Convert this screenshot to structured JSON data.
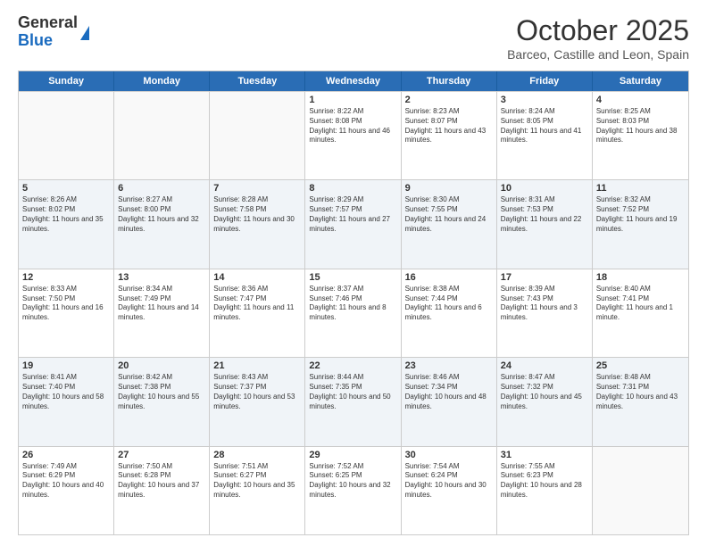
{
  "logo": {
    "general": "General",
    "blue": "Blue"
  },
  "title": "October 2025",
  "location": "Barceo, Castille and Leon, Spain",
  "header_days": [
    "Sunday",
    "Monday",
    "Tuesday",
    "Wednesday",
    "Thursday",
    "Friday",
    "Saturday"
  ],
  "weeks": [
    [
      {
        "date": "",
        "sunrise": "",
        "sunset": "",
        "daylight": ""
      },
      {
        "date": "",
        "sunrise": "",
        "sunset": "",
        "daylight": ""
      },
      {
        "date": "",
        "sunrise": "",
        "sunset": "",
        "daylight": ""
      },
      {
        "date": "1",
        "sunrise": "Sunrise: 8:22 AM",
        "sunset": "Sunset: 8:08 PM",
        "daylight": "Daylight: 11 hours and 46 minutes."
      },
      {
        "date": "2",
        "sunrise": "Sunrise: 8:23 AM",
        "sunset": "Sunset: 8:07 PM",
        "daylight": "Daylight: 11 hours and 43 minutes."
      },
      {
        "date": "3",
        "sunrise": "Sunrise: 8:24 AM",
        "sunset": "Sunset: 8:05 PM",
        "daylight": "Daylight: 11 hours and 41 minutes."
      },
      {
        "date": "4",
        "sunrise": "Sunrise: 8:25 AM",
        "sunset": "Sunset: 8:03 PM",
        "daylight": "Daylight: 11 hours and 38 minutes."
      }
    ],
    [
      {
        "date": "5",
        "sunrise": "Sunrise: 8:26 AM",
        "sunset": "Sunset: 8:02 PM",
        "daylight": "Daylight: 11 hours and 35 minutes."
      },
      {
        "date": "6",
        "sunrise": "Sunrise: 8:27 AM",
        "sunset": "Sunset: 8:00 PM",
        "daylight": "Daylight: 11 hours and 32 minutes."
      },
      {
        "date": "7",
        "sunrise": "Sunrise: 8:28 AM",
        "sunset": "Sunset: 7:58 PM",
        "daylight": "Daylight: 11 hours and 30 minutes."
      },
      {
        "date": "8",
        "sunrise": "Sunrise: 8:29 AM",
        "sunset": "Sunset: 7:57 PM",
        "daylight": "Daylight: 11 hours and 27 minutes."
      },
      {
        "date": "9",
        "sunrise": "Sunrise: 8:30 AM",
        "sunset": "Sunset: 7:55 PM",
        "daylight": "Daylight: 11 hours and 24 minutes."
      },
      {
        "date": "10",
        "sunrise": "Sunrise: 8:31 AM",
        "sunset": "Sunset: 7:53 PM",
        "daylight": "Daylight: 11 hours and 22 minutes."
      },
      {
        "date": "11",
        "sunrise": "Sunrise: 8:32 AM",
        "sunset": "Sunset: 7:52 PM",
        "daylight": "Daylight: 11 hours and 19 minutes."
      }
    ],
    [
      {
        "date": "12",
        "sunrise": "Sunrise: 8:33 AM",
        "sunset": "Sunset: 7:50 PM",
        "daylight": "Daylight: 11 hours and 16 minutes."
      },
      {
        "date": "13",
        "sunrise": "Sunrise: 8:34 AM",
        "sunset": "Sunset: 7:49 PM",
        "daylight": "Daylight: 11 hours and 14 minutes."
      },
      {
        "date": "14",
        "sunrise": "Sunrise: 8:36 AM",
        "sunset": "Sunset: 7:47 PM",
        "daylight": "Daylight: 11 hours and 11 minutes."
      },
      {
        "date": "15",
        "sunrise": "Sunrise: 8:37 AM",
        "sunset": "Sunset: 7:46 PM",
        "daylight": "Daylight: 11 hours and 8 minutes."
      },
      {
        "date": "16",
        "sunrise": "Sunrise: 8:38 AM",
        "sunset": "Sunset: 7:44 PM",
        "daylight": "Daylight: 11 hours and 6 minutes."
      },
      {
        "date": "17",
        "sunrise": "Sunrise: 8:39 AM",
        "sunset": "Sunset: 7:43 PM",
        "daylight": "Daylight: 11 hours and 3 minutes."
      },
      {
        "date": "18",
        "sunrise": "Sunrise: 8:40 AM",
        "sunset": "Sunset: 7:41 PM",
        "daylight": "Daylight: 11 hours and 1 minute."
      }
    ],
    [
      {
        "date": "19",
        "sunrise": "Sunrise: 8:41 AM",
        "sunset": "Sunset: 7:40 PM",
        "daylight": "Daylight: 10 hours and 58 minutes."
      },
      {
        "date": "20",
        "sunrise": "Sunrise: 8:42 AM",
        "sunset": "Sunset: 7:38 PM",
        "daylight": "Daylight: 10 hours and 55 minutes."
      },
      {
        "date": "21",
        "sunrise": "Sunrise: 8:43 AM",
        "sunset": "Sunset: 7:37 PM",
        "daylight": "Daylight: 10 hours and 53 minutes."
      },
      {
        "date": "22",
        "sunrise": "Sunrise: 8:44 AM",
        "sunset": "Sunset: 7:35 PM",
        "daylight": "Daylight: 10 hours and 50 minutes."
      },
      {
        "date": "23",
        "sunrise": "Sunrise: 8:46 AM",
        "sunset": "Sunset: 7:34 PM",
        "daylight": "Daylight: 10 hours and 48 minutes."
      },
      {
        "date": "24",
        "sunrise": "Sunrise: 8:47 AM",
        "sunset": "Sunset: 7:32 PM",
        "daylight": "Daylight: 10 hours and 45 minutes."
      },
      {
        "date": "25",
        "sunrise": "Sunrise: 8:48 AM",
        "sunset": "Sunset: 7:31 PM",
        "daylight": "Daylight: 10 hours and 43 minutes."
      }
    ],
    [
      {
        "date": "26",
        "sunrise": "Sunrise: 7:49 AM",
        "sunset": "Sunset: 6:29 PM",
        "daylight": "Daylight: 10 hours and 40 minutes."
      },
      {
        "date": "27",
        "sunrise": "Sunrise: 7:50 AM",
        "sunset": "Sunset: 6:28 PM",
        "daylight": "Daylight: 10 hours and 37 minutes."
      },
      {
        "date": "28",
        "sunrise": "Sunrise: 7:51 AM",
        "sunset": "Sunset: 6:27 PM",
        "daylight": "Daylight: 10 hours and 35 minutes."
      },
      {
        "date": "29",
        "sunrise": "Sunrise: 7:52 AM",
        "sunset": "Sunset: 6:25 PM",
        "daylight": "Daylight: 10 hours and 32 minutes."
      },
      {
        "date": "30",
        "sunrise": "Sunrise: 7:54 AM",
        "sunset": "Sunset: 6:24 PM",
        "daylight": "Daylight: 10 hours and 30 minutes."
      },
      {
        "date": "31",
        "sunrise": "Sunrise: 7:55 AM",
        "sunset": "Sunset: 6:23 PM",
        "daylight": "Daylight: 10 hours and 28 minutes."
      },
      {
        "date": "",
        "sunrise": "",
        "sunset": "",
        "daylight": ""
      }
    ]
  ]
}
